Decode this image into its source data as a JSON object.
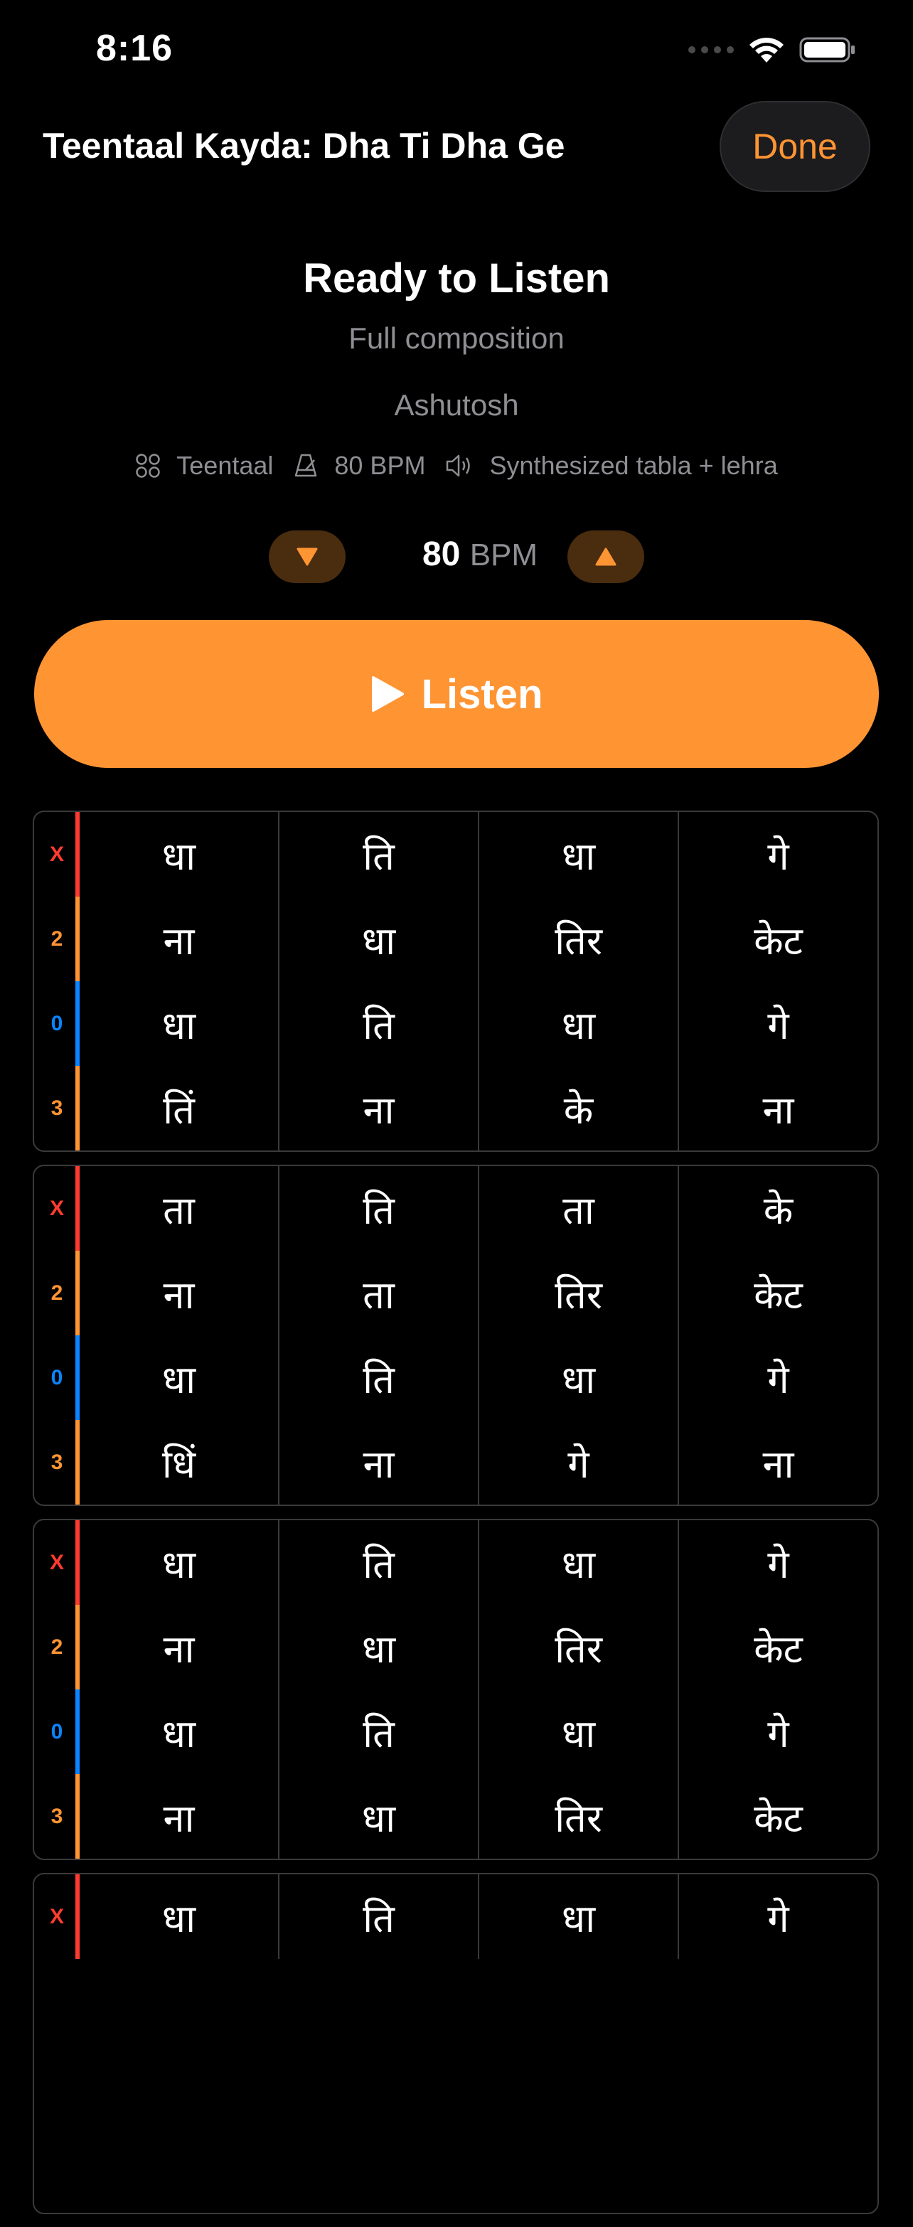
{
  "status_bar": {
    "time": "8:16"
  },
  "header": {
    "title": "Teentaal Kayda: Dha Ti Dha Ge",
    "done_label": "Done"
  },
  "player": {
    "status": "Ready to Listen",
    "subtitle": "Full composition",
    "author": "Ashutosh",
    "meta": {
      "taal": "Teentaal",
      "tempo": "80 BPM",
      "sound": "Synthesized tabla + lehra"
    },
    "tempo_value": "80",
    "tempo_unit": "BPM",
    "listen_label": "Listen"
  },
  "colors": {
    "accent": "#ff9433",
    "sam": "#ff3b30",
    "tali": "#ff9433",
    "khali": "#0a84ff"
  },
  "cycles": [
    {
      "rows": [
        {
          "marker": "X",
          "type": "sam",
          "bols": [
            "धा",
            "ति",
            "धा",
            "गे"
          ]
        },
        {
          "marker": "2",
          "type": "tali",
          "bols": [
            "ना",
            "धा",
            "तिर",
            "केट"
          ]
        },
        {
          "marker": "0",
          "type": "khali",
          "bols": [
            "धा",
            "ति",
            "धा",
            "गे"
          ]
        },
        {
          "marker": "3",
          "type": "tali",
          "bols": [
            "तिं",
            "ना",
            "के",
            "ना"
          ]
        }
      ]
    },
    {
      "rows": [
        {
          "marker": "X",
          "type": "sam",
          "bols": [
            "ता",
            "ति",
            "ता",
            "के"
          ]
        },
        {
          "marker": "2",
          "type": "tali",
          "bols": [
            "ना",
            "ता",
            "तिर",
            "केट"
          ]
        },
        {
          "marker": "0",
          "type": "khali",
          "bols": [
            "धा",
            "ति",
            "धा",
            "गे"
          ]
        },
        {
          "marker": "3",
          "type": "tali",
          "bols": [
            "धिं",
            "ना",
            "गे",
            "ना"
          ]
        }
      ]
    },
    {
      "rows": [
        {
          "marker": "X",
          "type": "sam",
          "bols": [
            "धा",
            "ति",
            "धा",
            "गे"
          ]
        },
        {
          "marker": "2",
          "type": "tali",
          "bols": [
            "ना",
            "धा",
            "तिर",
            "केट"
          ]
        },
        {
          "marker": "0",
          "type": "khali",
          "bols": [
            "धा",
            "ति",
            "धा",
            "गे"
          ]
        },
        {
          "marker": "3",
          "type": "tali",
          "bols": [
            "ना",
            "धा",
            "तिर",
            "केट"
          ]
        }
      ]
    },
    {
      "rows": [
        {
          "marker": "X",
          "type": "sam",
          "bols": [
            "धा",
            "ति",
            "धा",
            "गे"
          ]
        }
      ]
    }
  ]
}
